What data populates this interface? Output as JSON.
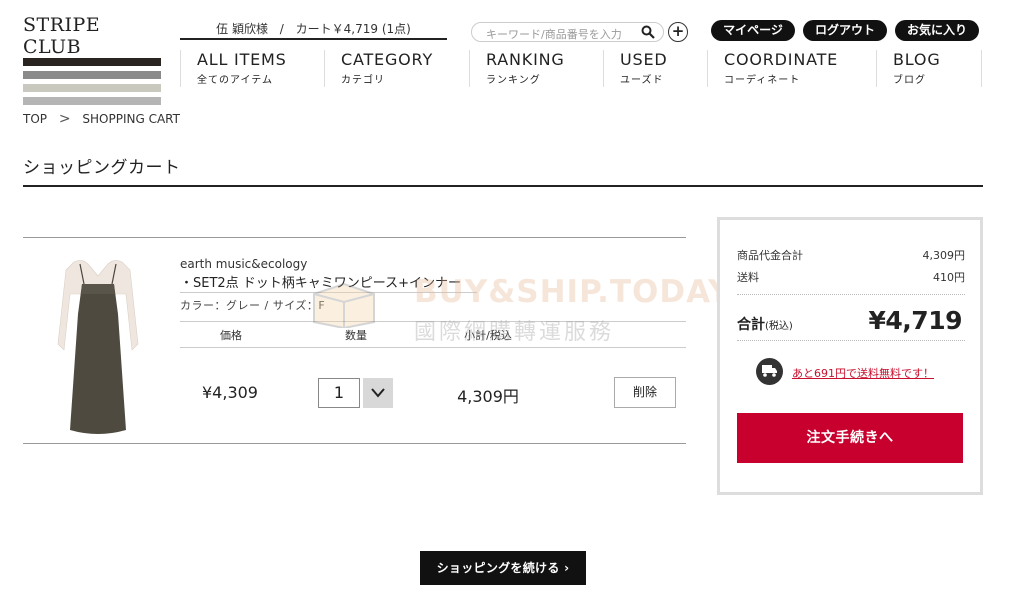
{
  "logo": {
    "text": "STRIPE CLUB"
  },
  "userbar": {
    "user": "伍 穎欣様",
    "sep": "/",
    "cart": "カート￥4,719 (1点)"
  },
  "search": {
    "placeholder": "キーワード/商品番号を入力"
  },
  "plus": "+",
  "top_links": {
    "mypage": "マイページ",
    "logout": "ログアウト",
    "favorites": "お気に入り"
  },
  "nav": [
    {
      "en": "ALL ITEMS",
      "ja": "全てのアイテム"
    },
    {
      "en": "CATEGORY",
      "ja": "カテゴリ"
    },
    {
      "en": "RANKING",
      "ja": "ランキング"
    },
    {
      "en": "USED",
      "ja": "ユーズド"
    },
    {
      "en": "COORDINATE",
      "ja": "コーディネート"
    },
    {
      "en": "BLOG",
      "ja": "ブログ"
    }
  ],
  "breadcrumb": {
    "top": "TOP",
    "sep": ">",
    "current": "SHOPPING CART"
  },
  "page_title": "ショッピングカート",
  "cart_item": {
    "brand": "earth music&ecology",
    "name": "・SET2点 ドット柄キャミワンピース+インナー",
    "variant": "カラー：グレー / サイズ：F",
    "headers": {
      "price": "価格",
      "qty": "数量",
      "subtotal": "小計/税込"
    },
    "price": "¥4,309",
    "qty": "1",
    "subtotal": "4,309円",
    "delete_label": "削除"
  },
  "watermark": {
    "title": "BUY&SHIP.TODAY",
    "sub": "國際網購轉運服務"
  },
  "summary": {
    "goods_label": "商品代金合計",
    "goods_value": "4,309円",
    "shipping_label": "送料",
    "shipping_value": "410円",
    "total_label": "合計",
    "total_tax": "(税込)",
    "total_value": "¥4,719",
    "free_shipping_note": "あと691円で送料無料です！",
    "checkout_label": "注文手続きへ"
  },
  "continue_label": "ショッピングを続ける ›",
  "colors": {
    "accent_red": "#c8002e",
    "dark": "#111111"
  }
}
